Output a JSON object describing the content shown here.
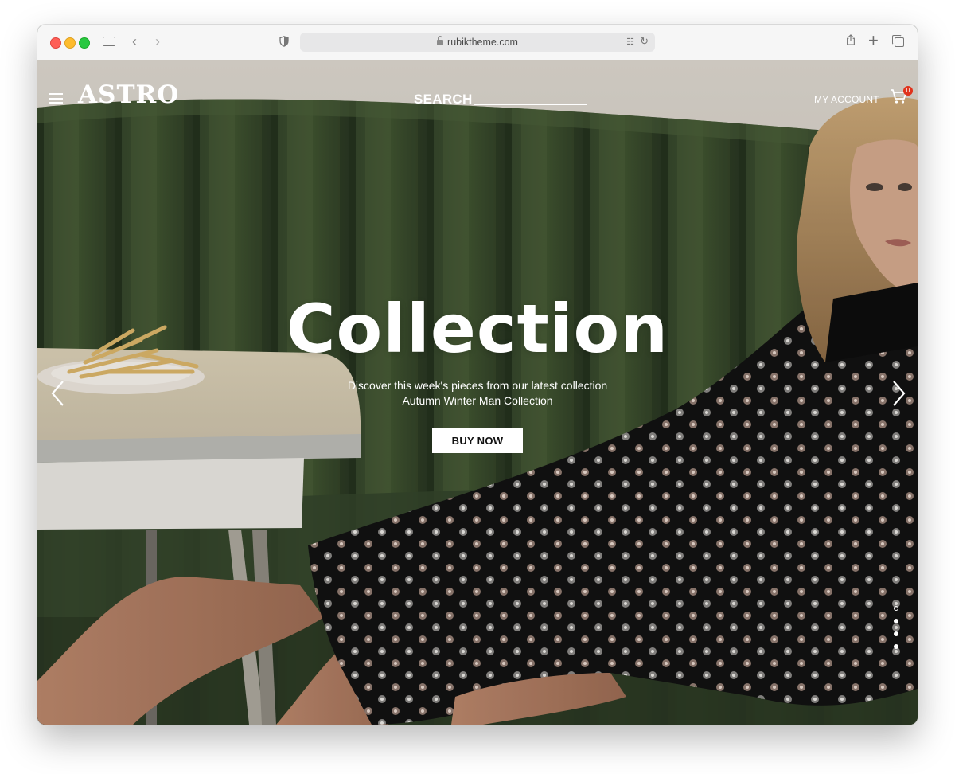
{
  "browser": {
    "url": "rubiktheme.com"
  },
  "header": {
    "logo": "ASTRO",
    "search_label": "SEARCH",
    "search_value": "",
    "account_label": "MY ACCOUNT",
    "cart_count": "0"
  },
  "hero": {
    "title": "Collection",
    "line1": "Discover this week's pieces from our latest collection",
    "line2": "Autumn Winter Man Collection",
    "cta_label": "BUY NOW",
    "slides": [
      "slide-1",
      "slide-2",
      "slide-3",
      "slide-4"
    ],
    "active_slide": 1
  },
  "colors": {
    "badge": "#e0331c",
    "couch_green": "#3d4f2c"
  }
}
